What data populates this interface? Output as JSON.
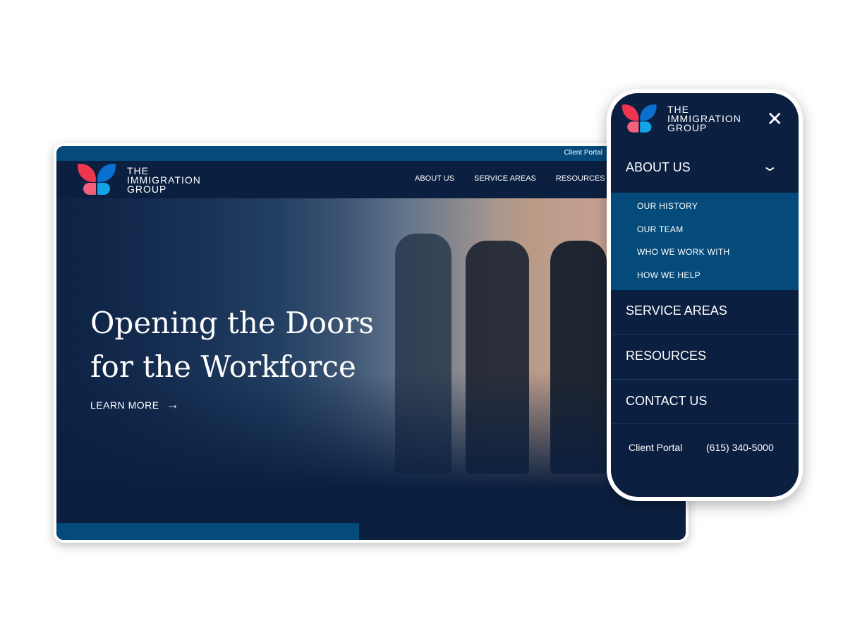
{
  "brand": {
    "name_lines": [
      "THE",
      "IMMIGRATION",
      "GROUP"
    ],
    "colors": {
      "navy": "#0b1f40",
      "blue": "#044a7b",
      "red": "#f0364f",
      "pink": "#f4607a",
      "wing_blue": "#0a6fce",
      "wing_cyan": "#12a4e6"
    }
  },
  "desktop": {
    "top_link": "Client Portal",
    "nav": [
      "ABOUT US",
      "SERVICE AREAS",
      "RESOURCES"
    ],
    "hero": {
      "headline_1": "Opening the Doors",
      "headline_2": "for the Workforce",
      "cta": "LEARN MORE",
      "cta_icon": "arrow-right-icon"
    }
  },
  "mobile": {
    "close_icon": "close-icon",
    "menu": [
      {
        "label": "ABOUT US",
        "expanded": true,
        "children": [
          "OUR HISTORY",
          "OUR TEAM",
          "WHO WE WORK WITH",
          "HOW WE HELP"
        ]
      },
      {
        "label": "SERVICE AREAS"
      },
      {
        "label": "RESOURCES"
      },
      {
        "label": "CONTACT US"
      }
    ],
    "footer": {
      "portal": "Client Portal",
      "phone": "(615) 340-5000"
    }
  }
}
